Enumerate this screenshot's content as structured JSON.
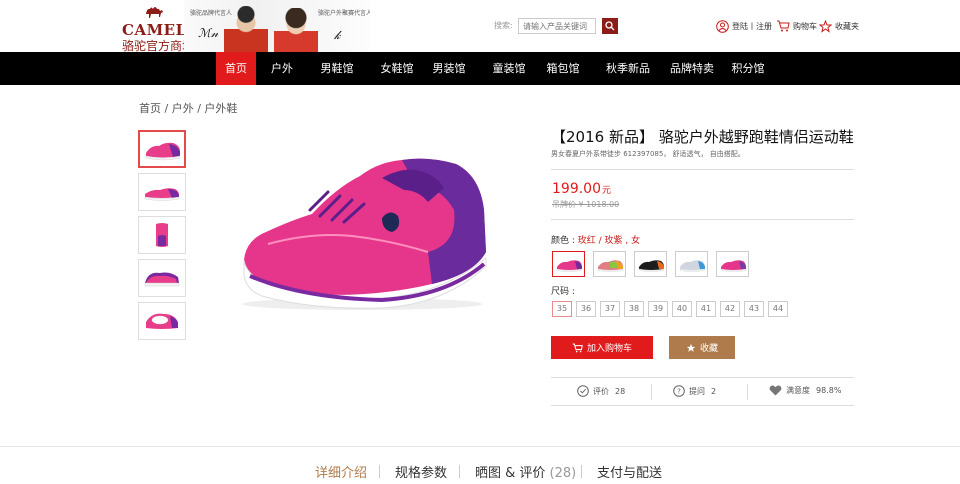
{
  "header": {
    "brand_en": "CAMEL",
    "brand_cn": "骆驼官方商城",
    "banner_caption_left": "骆驼品牌代言人",
    "banner_caption_right": "骆驼户外聚赛代言人",
    "search_label": "搜索:",
    "search_placeholder": "请输入产品关键词",
    "login_label": "登陆丨注册",
    "cart_label": "购物车",
    "favorites_label": "收藏夹"
  },
  "nav": {
    "items": [
      "首页",
      "户外",
      "男鞋馆",
      "女鞋馆",
      "男装馆",
      "童装馆",
      "箱包馆",
      "秋季新品",
      "品牌特卖",
      "积分馆"
    ],
    "active_index": 0
  },
  "breadcrumb": "首页 / 户外 / 户外鞋",
  "product": {
    "title": "【2016 新品】 骆驼户外越野跑鞋情侣运动鞋",
    "subtitle": "男女春夏户外系带徒步 612397085， 舒适透气， 自由搭配。",
    "price": "199.00",
    "price_unit": "元",
    "orig_price_label": "吊牌价 ¥ 1018.00",
    "color_label": "颜色 : ",
    "color_value": "玫红 / 玫紫 , 女",
    "size_label": "尺码 :",
    "sizes": [
      "35",
      "36",
      "37",
      "38",
      "39",
      "40",
      "41",
      "42",
      "43",
      "44"
    ],
    "add_to_cart": "加入购物车",
    "favorite": "收藏",
    "stats": {
      "reviews_label": "评价",
      "reviews_count": "28",
      "questions_label": "提问",
      "questions_count": "2",
      "satisfaction_label": "满意度",
      "satisfaction_value": "98.8%"
    }
  },
  "colors": {
    "accent_red": "#e11b1b",
    "brand_brown": "#8b1c16",
    "favorite_brown": "#b07b4c"
  },
  "tabs": {
    "detail": "详细介绍",
    "specs": "规格参数",
    "reviews": "晒图 & 评价",
    "reviews_count": "(28)",
    "shipping": "支付与配送"
  }
}
